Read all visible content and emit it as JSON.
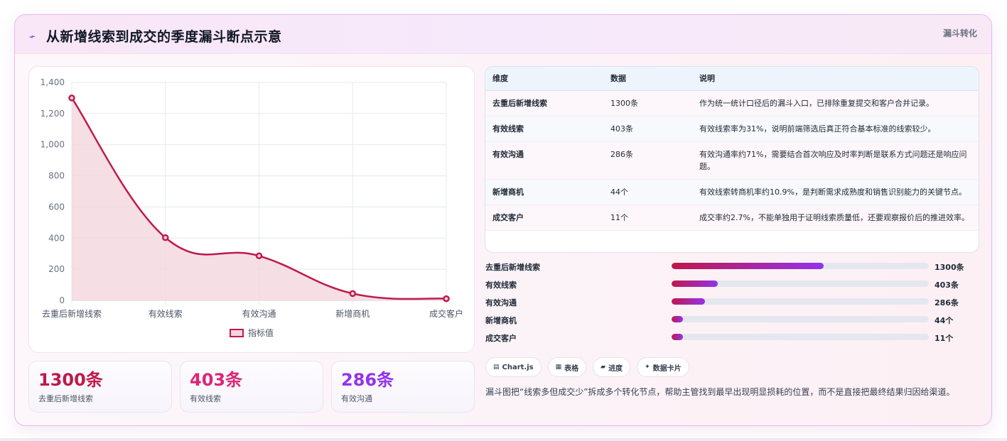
{
  "header": {
    "title": "从新增线索到成交的季度漏斗断点示意",
    "tag": "漏斗转化",
    "icon": "pulse-icon"
  },
  "chart_data": {
    "type": "line",
    "categories": [
      "去重后新增线索",
      "有效线索",
      "有效沟通",
      "新增商机",
      "成交客户"
    ],
    "series": [
      {
        "name": "指标值",
        "values": [
          1300,
          403,
          286,
          44,
          11
        ]
      }
    ],
    "y_ticks": [
      "0",
      "200",
      "400",
      "600",
      "800",
      "1,000",
      "1,200",
      "1,400"
    ],
    "ylim": [
      0,
      1400
    ],
    "fill": true,
    "grid": true,
    "legend": "bottom",
    "colors": {
      "line": "#be1a4c",
      "fill": "#f4d6df"
    }
  },
  "stats": [
    {
      "value": "1300条",
      "label": "去重后新增线索",
      "color": "#be1a4c"
    },
    {
      "value": "403条",
      "label": "有效线索",
      "color": "#db2777"
    },
    {
      "value": "286条",
      "label": "有效沟通",
      "color": "#9333ea"
    }
  ],
  "table": {
    "headers": [
      "维度",
      "数据",
      "说明"
    ],
    "rows": [
      [
        "去重后新增线索",
        "1300条",
        "作为统一统计口径后的漏斗入口，已排除重复提交和客户合并记录。"
      ],
      [
        "有效线索",
        "403条",
        "有效线索率为31%，说明前端筛选后真正符合基本标准的线索较少。"
      ],
      [
        "有效沟通",
        "286条",
        "有效沟通率约71%，需要结合首次响应及时率判断是联系方式问题还是响应问题。"
      ],
      [
        "新增商机",
        "44个",
        "有效线索转商机率约10.9%，是判断需求成熟度和销售识别能力的关键节点。"
      ],
      [
        "成交客户",
        "11个",
        "成交率约2.7%，不能单独用于证明线索质量低，还要观察报价后的推进效率。"
      ]
    ]
  },
  "progress": [
    {
      "label": "去重后新增线索",
      "value": "1300条",
      "fraction": 0.59
    },
    {
      "label": "有效线索",
      "value": "403条",
      "fraction": 0.18
    },
    {
      "label": "有效沟通",
      "value": "286条",
      "fraction": 0.13
    },
    {
      "label": "新增商机",
      "value": "44个",
      "fraction": 0.045
    },
    {
      "label": "成交客户",
      "value": "11个",
      "fraction": 0.045
    }
  ],
  "chips": [
    {
      "icon": "chart-icon",
      "glyph": "▤",
      "label": "Chart.js"
    },
    {
      "icon": "table-icon",
      "glyph": "▦",
      "label": "表格"
    },
    {
      "icon": "progress-icon",
      "glyph": "▰",
      "label": "进度"
    },
    {
      "icon": "card-icon",
      "glyph": "✦",
      "label": "数据卡片"
    }
  ],
  "note": "漏斗图把“线索多但成交少”拆成多个转化节点，帮助主管找到最早出现明显损耗的位置，而不是直接把最终结果归因给渠道。"
}
